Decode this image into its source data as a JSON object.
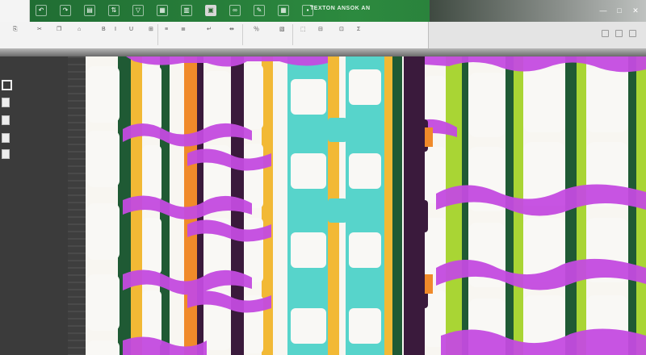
{
  "app": {
    "file_tab_label": "",
    "document_title": "TEXTON ANSOK AN",
    "window_controls": [
      "minimize",
      "maximize",
      "close"
    ]
  },
  "toolbar": {
    "quick_access_icons": [
      "undo-icon",
      "redo-icon",
      "format-icon",
      "sort-icon",
      "filter-icon",
      "table-icon",
      "chart-icon",
      "pivot-icon",
      "link-icon",
      "comment-icon",
      "grid-icon",
      "save-icon"
    ],
    "group_labels": [
      "",
      "",
      "",
      "",
      "",
      "",
      "",
      ""
    ]
  },
  "side_pane": {
    "items": [
      {
        "label": "",
        "icon": "table-icon"
      },
      {
        "label": "",
        "icon": "document-icon"
      },
      {
        "label": "",
        "icon": "chart-icon"
      },
      {
        "label": "",
        "icon": "folder-icon"
      },
      {
        "label": "",
        "icon": "sheet-icon"
      }
    ]
  },
  "colors": {
    "brand_green": "#2c8a3f",
    "purple": "#c44be0",
    "teal": "#57d4cb",
    "yellow": "#f2b935",
    "lime": "#a9d534",
    "dark_green": "#1f5a34",
    "deep_purple": "#3a1a3c",
    "orange": "#f08a2a",
    "white": "#f9f8f5"
  }
}
